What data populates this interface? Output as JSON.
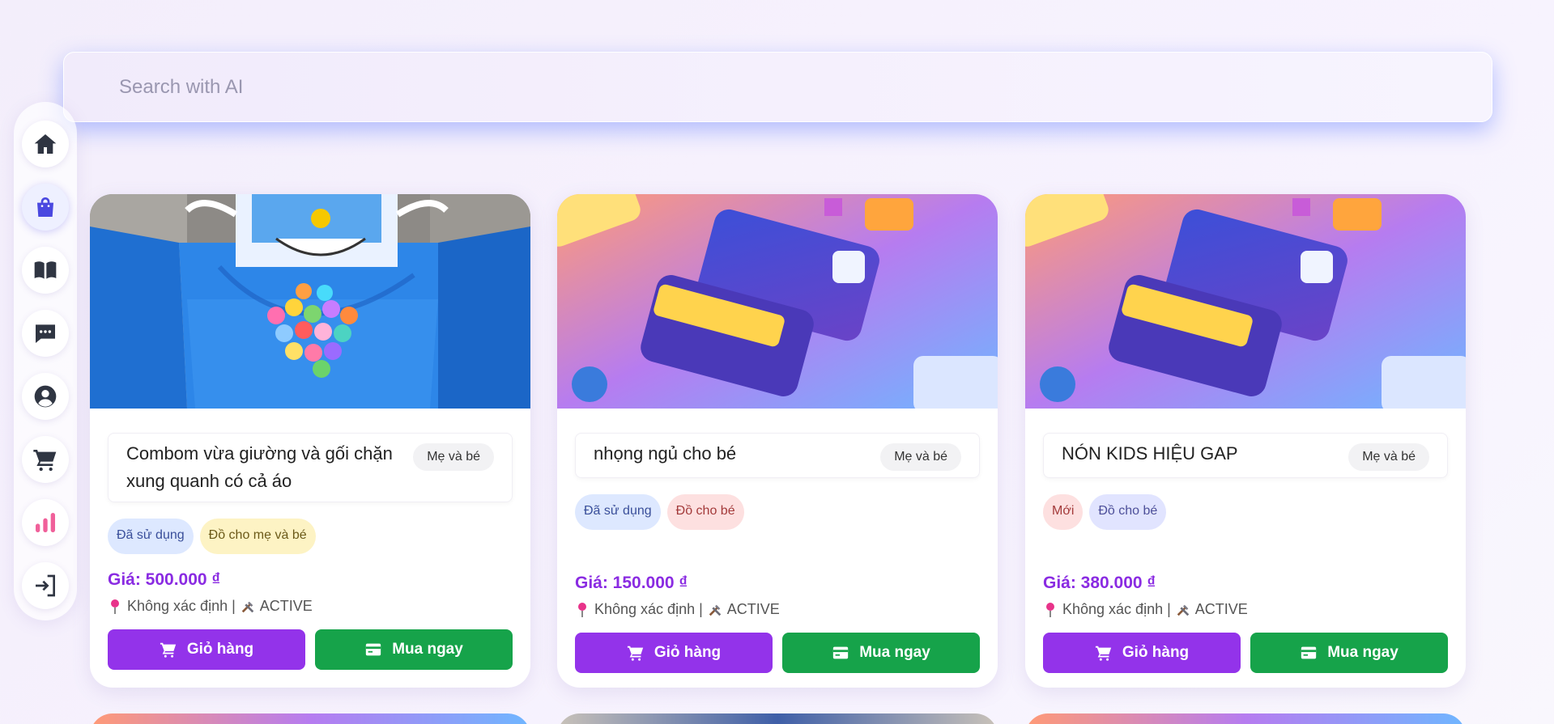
{
  "search": {
    "placeholder": "Search with AI"
  },
  "sidebar": {
    "items": [
      {
        "icon": "home-icon"
      },
      {
        "icon": "shopping-bag-icon"
      },
      {
        "icon": "book-icon"
      },
      {
        "icon": "chat-icon"
      },
      {
        "icon": "user-icon"
      },
      {
        "icon": "cart-icon"
      },
      {
        "icon": "chart-icon"
      },
      {
        "icon": "login-icon"
      }
    ]
  },
  "products": [
    {
      "title": "Combom vừa giường và gối chặn xung quanh có cả áo",
      "category": "Mẹ và bé",
      "tags": [
        "Đã sử dụng",
        "Đồ cho mẹ và bé"
      ],
      "price": "Giá: 500.000 ₫",
      "location": "Không xác định | ",
      "status": "ACTIVE",
      "cart_label": "Giỏ hàng",
      "buy_label": "Mua ngay"
    },
    {
      "title": "nhọng ngủ cho bé",
      "category": "Mẹ và bé",
      "tags": [
        "Đã sử dụng",
        "Đồ cho bé"
      ],
      "price": "Giá: 150.000 ₫",
      "location": "Không xác định | ",
      "status": "ACTIVE",
      "cart_label": "Giỏ hàng",
      "buy_label": "Mua ngay"
    },
    {
      "title": "NÓN KIDS HIỆU GAP",
      "category": "Mẹ và bé",
      "tags": [
        "Mới",
        "Đồ cho bé"
      ],
      "price": "Giá: 380.000 ₫",
      "location": "Không xác định | ",
      "status": "ACTIVE",
      "cart_label": "Giỏ hàng",
      "buy_label": "Mua ngay"
    }
  ],
  "colors": {
    "accent_purple": "#9333ea",
    "accent_green": "#16a34a",
    "price": "#8a2be2"
  }
}
